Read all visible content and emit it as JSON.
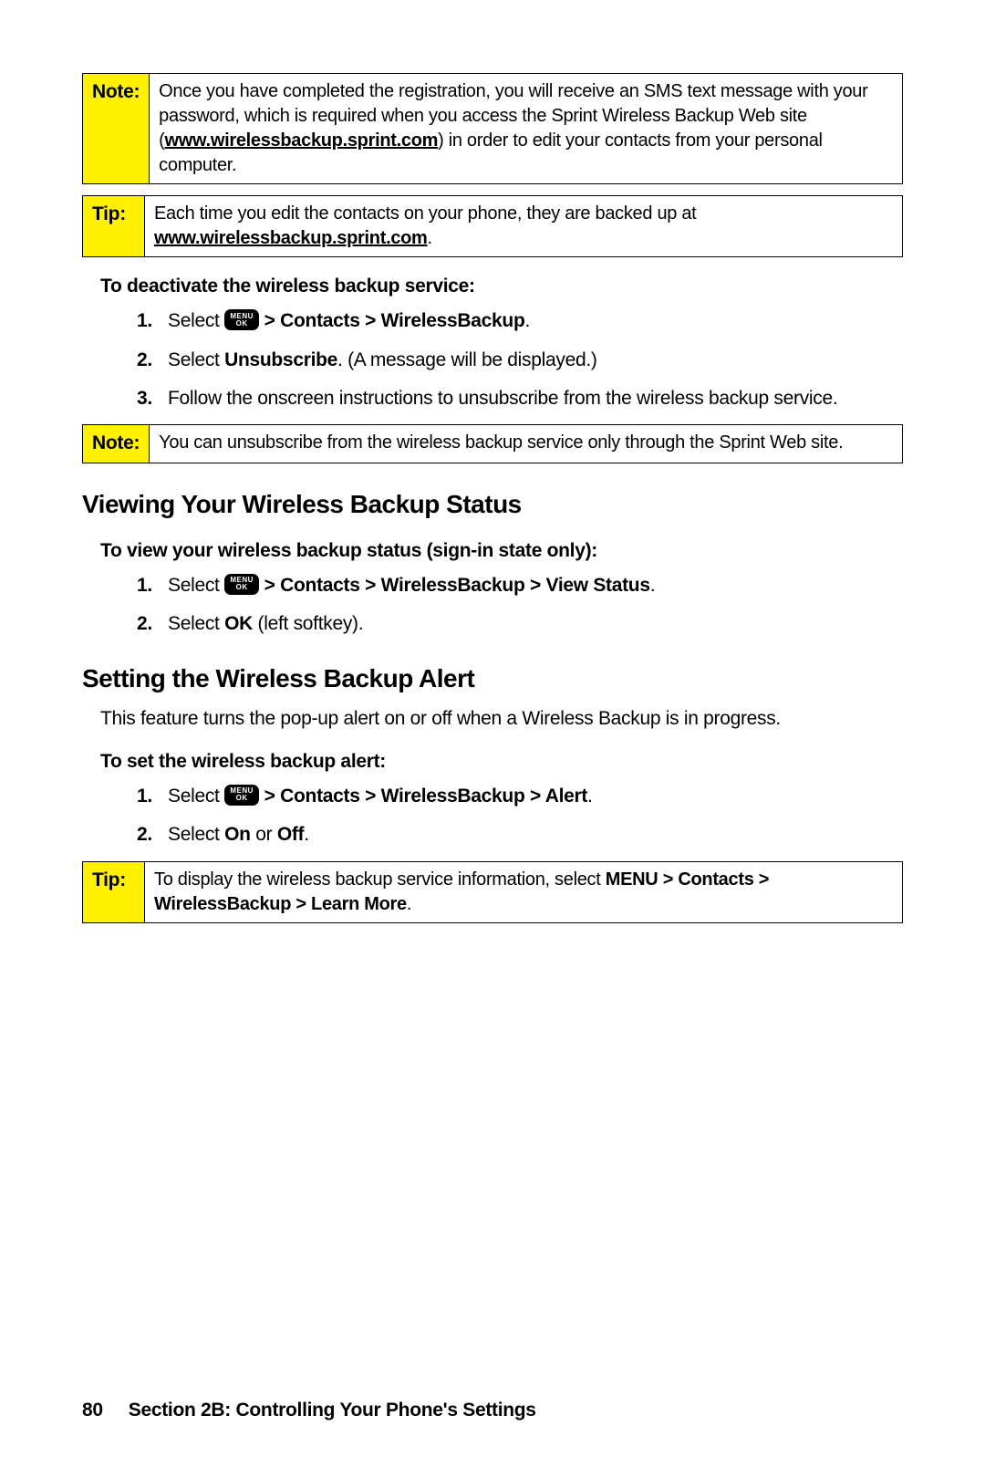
{
  "note1": {
    "label": "Note:",
    "text_before": "Once you have completed the registration, you will receive an SMS text message with your password, which is required when you access the Sprint Wireless Backup Web site (",
    "url": "www.wirelessbackup.sprint.com",
    "text_after": ") in order to edit your contacts from your personal computer."
  },
  "tip1": {
    "label": "Tip:",
    "text_before": "Each time you edit the contacts on your phone, they are backed up at ",
    "url": "www.wirelessbackup.sprint.com",
    "text_after": "."
  },
  "deactivate": {
    "heading": "To deactivate the wireless backup service:",
    "steps": {
      "s1_num": "1.",
      "s1_a": "Select ",
      "s1_b": " > Contacts > WirelessBackup",
      "s1_c": ".",
      "s2_num": "2.",
      "s2_a": "Select ",
      "s2_b": "Unsubscribe",
      "s2_c": ". (A message will be displayed.)",
      "s3_num": "3.",
      "s3": "Follow the onscreen instructions to unsubscribe from the wireless backup service."
    }
  },
  "note2": {
    "label": "Note:",
    "text": "You can unsubscribe from the wireless backup service only through the Sprint Web site."
  },
  "viewing": {
    "heading": "Viewing Your Wireless Backup Status",
    "sub": "To view your wireless backup status (sign-in state only):",
    "s1_num": "1.",
    "s1_a": "Select ",
    "s1_b": " > Contacts > WirelessBackup > View Status",
    "s1_c": ".",
    "s2_num": "2.",
    "s2_a": "Select ",
    "s2_b": "OK",
    "s2_c": " (left softkey)."
  },
  "setting": {
    "heading": "Setting the Wireless Backup Alert",
    "para": "This feature turns the pop-up alert on or off when a Wireless Backup is in progress.",
    "sub": "To set the wireless backup alert:",
    "s1_num": "1.",
    "s1_a": "Select ",
    "s1_b": " > Contacts > WirelessBackup > Alert",
    "s1_c": ".",
    "s2_num": "2.",
    "s2_a": "Select ",
    "s2_b": "On",
    "s2_c": " or ",
    "s2_d": "Off",
    "s2_e": "."
  },
  "tip2": {
    "label": "Tip:",
    "text_a": "To display the wireless backup service information, select ",
    "text_b": "MENU > Contacts > WirelessBackup > Learn More",
    "text_c": "."
  },
  "menu_key": {
    "line1": "MENU",
    "line2": "OK"
  },
  "footer": {
    "page": "80",
    "section": "Section 2B: Controlling Your Phone's Settings"
  }
}
